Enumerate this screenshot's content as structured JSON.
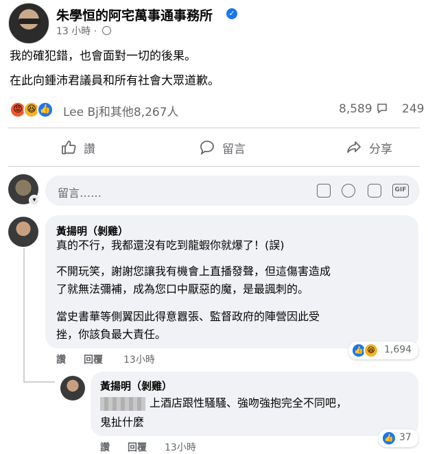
{
  "post": {
    "page_name": "朱學恒的阿宅萬事通事務所",
    "time": "13 小時 ·",
    "lines": [
      "我的確犯錯，也會面對一切的後果。",
      "在此向鍾沛君議員和所有社會大眾道歉。"
    ],
    "reaction_summary": "Lee Bj和其他8,267人",
    "comment_count": "8,589",
    "share_count": "249"
  },
  "actions": {
    "like": "讚",
    "comment": "留言",
    "share": "分享"
  },
  "composer": {
    "placeholder": "留言……"
  },
  "comments": [
    {
      "author": "黃揚明（剝雞）",
      "paragraphs": [
        [
          "真的不行，我都還沒有吃到龍蝦你就爆了！(誤)"
        ],
        [
          "不開玩笑，謝謝您讓我有機會上直播發聲，但這傷害造成",
          "了就無法彌補，成為您口中厭惡的魔，是最諷刺的。"
        ],
        [
          "當史書華等側翼因此得意囂張、監督政府的陣營因此受",
          "挫，你該負最大責任。"
        ]
      ],
      "like_label": "讚",
      "reply_label": "回覆",
      "time": "13小時",
      "reaction_count": "1,694"
    },
    {
      "author": "黃揚明（剝雞）",
      "lines": [
        "上酒店跟性騷騷、強吻強抱完全不同吧，",
        "鬼扯什麼"
      ],
      "like_label": "讚",
      "reply_label": "回覆",
      "time": "13小時",
      "reaction_count": "37"
    }
  ],
  "icons": [
    "verified-badge-icon",
    "globe-icon",
    "like-icon",
    "comment-icon",
    "share-icon",
    "sticker-icon",
    "emoji-icon",
    "camera-icon",
    "gif-icon"
  ],
  "colors": {
    "accent": "#1877f2",
    "muted": "#65676b",
    "bubble": "#f0f2f5"
  }
}
